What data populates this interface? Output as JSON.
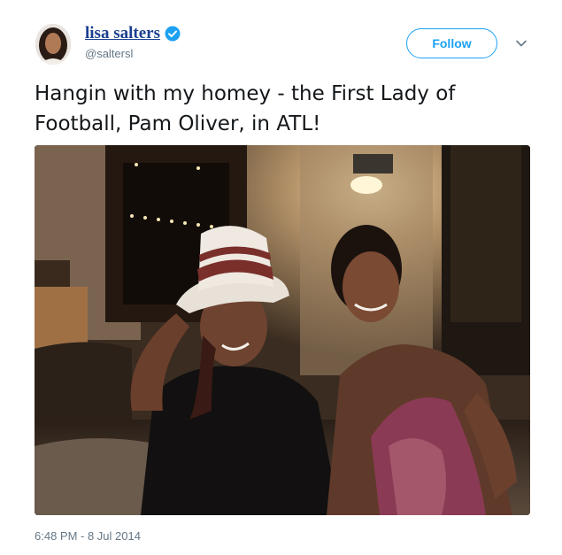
{
  "user": {
    "display_name": "lisa salters",
    "handle": "@saltersl",
    "verified": true
  },
  "follow_button": {
    "label": "Follow"
  },
  "tweet": {
    "text_line1": "Hangin with my homey - the First Lady of",
    "text_line2": "Football, Pam Oliver, in ATL!",
    "timestamp": "6:48 PM - 8 Jul 2014"
  },
  "colors": {
    "name_link": "#1a3f8f",
    "accent": "#1da1f2",
    "secondary_text": "#657786",
    "body_text": "#14171a"
  },
  "icons": {
    "verified": "verified-badge-icon",
    "menu": "chevron-down-icon"
  }
}
